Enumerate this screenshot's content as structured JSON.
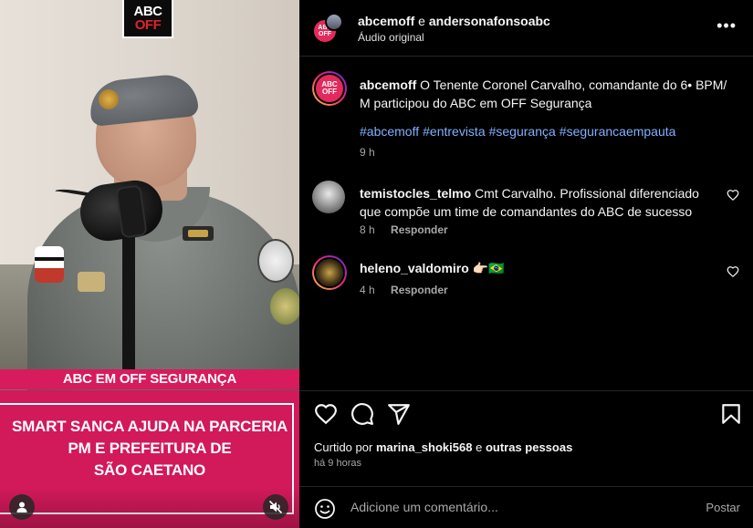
{
  "media": {
    "logo_top": "ABC",
    "logo_bottom_left": "",
    "logo_bottom_accent": "OFF",
    "caption_top": "ABC EM OFF SEGURANÇA",
    "caption_main_line1": "SMART SANCA AJUDA NA PARCERIA",
    "caption_main_line2": "PM E PREFEITURA DE",
    "caption_main_line3": "SÃO CAETANO"
  },
  "header": {
    "user1": "abcemoff",
    "connector": "e",
    "user2": "andersonafonsoabc",
    "audio": "Áudio original",
    "more": "•••"
  },
  "post": {
    "avatar_text": "ABC OFF",
    "username": "abcemoff",
    "text": "O Tenente Coronel Carvalho, comandante do 6• BPM/ M participou do ABC em OFF Segurança",
    "hashtags": [
      "#abcemoff",
      "#entrevista",
      "#segurança",
      "#segurancaempauta"
    ],
    "time": "9 h"
  },
  "comments": [
    {
      "username": "temistocles_telmo",
      "text": "Cmt Carvalho. Profissional diferenciado que compõe um time de comandantes do ABC de sucesso",
      "time": "8 h",
      "reply": "Responder"
    },
    {
      "username": "heleno_valdomiro",
      "text": "👉🏻🇧🇷",
      "time": "4 h",
      "reply": "Responder"
    }
  ],
  "actions": {
    "liked_prefix": "Curtido por",
    "liked_user": "marina_shoki568",
    "liked_suffix": "e",
    "liked_others": "outras pessoas",
    "ago": "há 9 horas"
  },
  "composer": {
    "placeholder": "Adicione um comentário...",
    "post": "Postar"
  },
  "colors": {
    "caption_pink": "#d81b5c",
    "hashtag_blue": "#7fb0ff",
    "muted": "#a8a8a8"
  }
}
